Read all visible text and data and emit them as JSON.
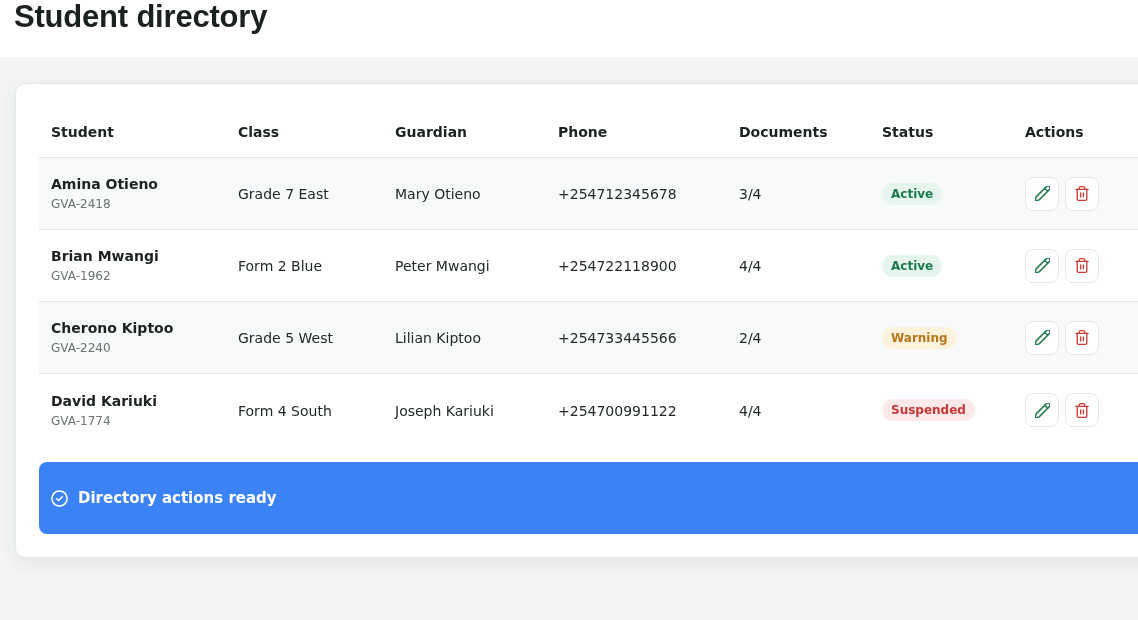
{
  "page": {
    "title": "Student directory"
  },
  "table": {
    "columns": [
      "Student",
      "Class",
      "Guardian",
      "Phone",
      "Documents",
      "Status",
      "Actions"
    ],
    "rows": [
      {
        "name": "Amina Otieno",
        "id": "GVA-2418",
        "class": "Grade 7 East",
        "guardian": "Mary Otieno",
        "phone": "+254712345678",
        "documents": "3/4",
        "status": {
          "label": "Active",
          "kind": "active"
        }
      },
      {
        "name": "Brian Mwangi",
        "id": "GVA-1962",
        "class": "Form 2 Blue",
        "guardian": "Peter Mwangi",
        "phone": "+254722118900",
        "documents": "4/4",
        "status": {
          "label": "Active",
          "kind": "active"
        }
      },
      {
        "name": "Cherono Kiptoo",
        "id": "GVA-2240",
        "class": "Grade 5 West",
        "guardian": "Lilian Kiptoo",
        "phone": "+254733445566",
        "documents": "2/4",
        "status": {
          "label": "Warning",
          "kind": "warning"
        }
      },
      {
        "name": "David Kariuki",
        "id": "GVA-1774",
        "class": "Form 4 South",
        "guardian": "Joseph Kariuki",
        "phone": "+254700991122",
        "documents": "4/4",
        "status": {
          "label": "Suspended",
          "kind": "suspended"
        }
      }
    ]
  },
  "banner": {
    "text": "Directory actions ready"
  }
}
